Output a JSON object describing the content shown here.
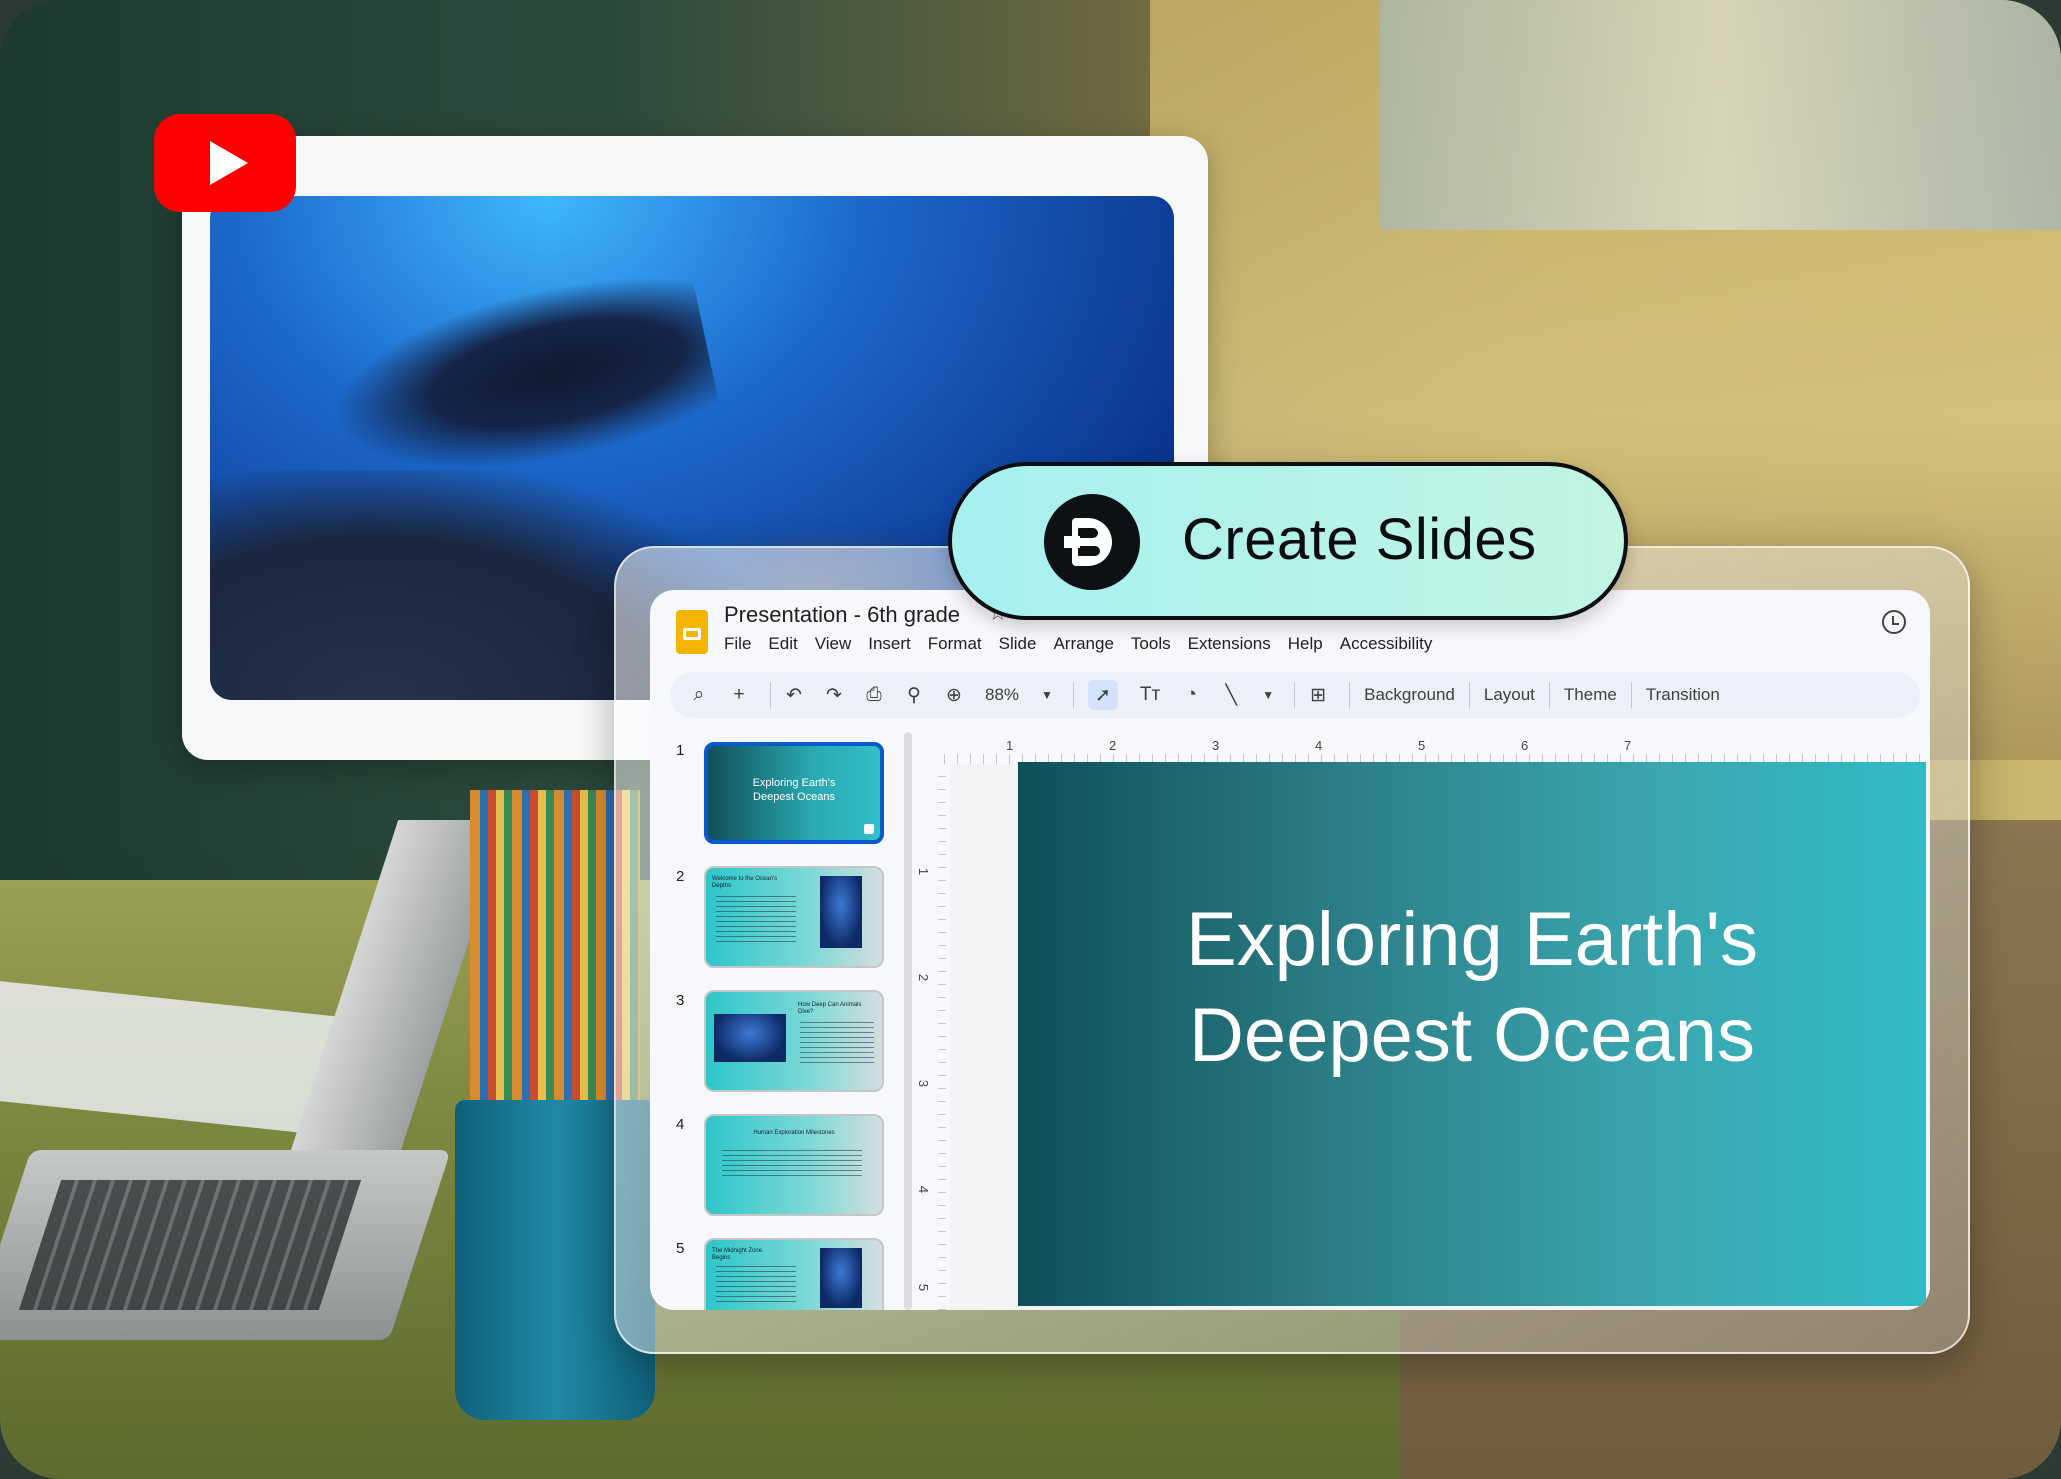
{
  "presentation": {
    "title": "Presentation - 6th grade",
    "menu": [
      "File",
      "Edit",
      "View",
      "Insert",
      "Format",
      "Slide",
      "Arrange",
      "Tools",
      "Extensions",
      "Help",
      "Accessibility"
    ]
  },
  "toolbar": {
    "zoom": "88%",
    "background_label": "Background",
    "layout_label": "Layout",
    "theme_label": "Theme",
    "transition_label": "Transition"
  },
  "slides": [
    {
      "number": "1",
      "title": "Exploring Earth's Deepest Oceans"
    },
    {
      "number": "2",
      "title": "Welcome to the Ocean's Depths"
    },
    {
      "number": "3",
      "title": "How Deep Can Animals Dive?"
    },
    {
      "number": "4",
      "title": "Human Exploration Milestones"
    },
    {
      "number": "5",
      "title": "The Midnight Zone Begins"
    }
  ],
  "current_slide": {
    "title_line1": "Exploring Earth's",
    "title_line2": "Deepest Oceans"
  },
  "ruler": {
    "top": [
      "1",
      "2",
      "3",
      "4",
      "5",
      "6",
      "7"
    ],
    "left": [
      "1",
      "2",
      "3",
      "4",
      "5"
    ]
  },
  "cta": {
    "label": "Create Slides"
  },
  "colors": {
    "youtube_red": "#ff0000",
    "slide_gradient_start": "#0e4f58",
    "slide_gradient_end": "#31bcc5",
    "cta_background": "#b0f2ec"
  }
}
